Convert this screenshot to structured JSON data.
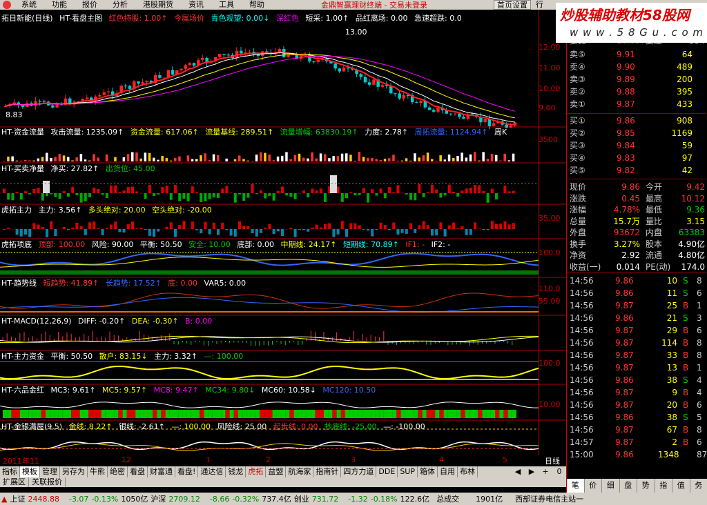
{
  "menu": {
    "items": [
      "系统",
      "功能",
      "报价",
      "分析",
      "港股期货",
      "资讯",
      "工具",
      "帮助"
    ],
    "app_title": "金鼎智赢理财终端 - 交易未登录",
    "home_btn": "首页设置",
    "row_btn": "行"
  },
  "watermark": {
    "line1": "炒股辅助教材58股网",
    "line2": "w w w . 5 8 G u . c o m"
  },
  "panels": {
    "main": {
      "items": [
        "拓日新能(日线)",
        "HT-看盘主图",
        "红色持股: 1.00↑",
        "今属场价",
        "青色观望: 0.00↓",
        "深红色",
        "短采: 1.00↑",
        "品红离场: 0.00",
        "急速超跌: 0.0"
      ],
      "yticks": [
        "12.00",
        "11.00",
        "10.00",
        "9.00"
      ],
      "annot": "13.00",
      "low": "8.83"
    },
    "p1": {
      "items": [
        "HT-资金流量",
        "攻击流量: 1235.09↑",
        "资金流量: 617.06↑",
        "流量基线: 289.51↑",
        "流量增幅: 63830.19↑",
        "力度: 2.78↑",
        "周拓流量: 1124.94↑",
        "周K"
      ],
      "ytick": "3500"
    },
    "p2": {
      "items": [
        "HT-买卖净量",
        "净买: 27.82↑",
        "出货位: 45.00"
      ]
    },
    "p3": {
      "items": [
        "虎拓主力",
        "主力: 3.56↑",
        "多头绝对: 20.00",
        "空头绝对: -20.00"
      ],
      "ytick": "35.00"
    },
    "p4": {
      "items": [
        "虎拓项底",
        "顶部: 100.00",
        "风险: 90.00",
        "平衡: 50.50",
        "安全: 10.00",
        "底部: 0.00",
        "中期线: 24.17↑",
        "短期线: 70.89↑",
        "IF1: -",
        "IF2: -"
      ],
      "ytick": "100.0"
    },
    "p5": {
      "items": [
        "HT-趋势线",
        "短趋势: 41.89↑",
        "长趋势: 17.52↑",
        "底: 0.00",
        "VAR5: 0.00"
      ],
      "yticks": [
        "110.0",
        "55.00"
      ]
    },
    "p6": {
      "items": [
        "HT-MACD(12,26,9)",
        "DIFF: -0.20↑",
        "DEA: -0.30↑",
        "B: 0.00"
      ]
    },
    "p7": {
      "items": [
        "HT-主力资金",
        "平衡: 50.50",
        "散户: 83.15↓",
        "主力: 3.32↑",
        "—: 100.00"
      ],
      "ytick": "100.0"
    },
    "p8": {
      "items": [
        "HT-六品金红",
        "MC3: 9.61↑",
        "MC5: 9.57↑",
        "MC8: 9.47↑",
        "MC34: 9.80↓",
        "MC60: 10.58↓",
        "MC120: 10.50"
      ],
      "ytick": "10.00"
    },
    "p9": {
      "items": [
        "HT-金银满屋(9,5)",
        "金线: 8.22↑",
        "银线: -2.61↑",
        "—: 100.00",
        "风险线: 25.00",
        "起步线: 0.00",
        "抄底线: -25.00",
        "—: -100.00"
      ]
    }
  },
  "dates": [
    "2011年11",
    "12",
    "1",
    "2",
    "3",
    "4",
    "5"
  ],
  "day_label": "日线",
  "tabs": [
    "指标",
    "模板",
    "管理",
    "另存为",
    "牛熊",
    "绝密",
    "看盘",
    "财富通",
    "看盘!",
    "通达信",
    "钱龙",
    "虎拓",
    "益盟",
    "航海家",
    "指南针",
    "四方力道",
    "DDE",
    "SUP",
    "箱体",
    "自用",
    "布林"
  ],
  "tabs2": [
    "扩展区",
    "关联报价"
  ],
  "tab_controls": [
    "◀",
    "▶",
    "+",
    "0"
  ],
  "orderbook": {
    "head": {
      "label": "委比",
      "value": "10.00%",
      "label2": "委差",
      "value2": "334"
    },
    "sells": [
      {
        "label": "卖⑤",
        "price": "9.91",
        "qty": "64"
      },
      {
        "label": "卖④",
        "price": "9.90",
        "qty": "489"
      },
      {
        "label": "卖③",
        "price": "9.89",
        "qty": "200"
      },
      {
        "label": "卖②",
        "price": "9.88",
        "qty": "395"
      },
      {
        "label": "卖①",
        "price": "9.87",
        "qty": "433"
      }
    ],
    "buys": [
      {
        "label": "买①",
        "price": "9.86",
        "qty": "908"
      },
      {
        "label": "买②",
        "price": "9.85",
        "qty": "1169"
      },
      {
        "label": "买③",
        "price": "9.84",
        "qty": "59"
      },
      {
        "label": "买④",
        "price": "9.83",
        "qty": "97"
      },
      {
        "label": "买⑤",
        "price": "9.82",
        "qty": "42"
      }
    ]
  },
  "quote": [
    {
      "k": "现价",
      "v": "9.86",
      "k2": "今开",
      "v2": "9.42"
    },
    {
      "k": "涨跌",
      "v": "0.45",
      "k2": "最高",
      "v2": "10.12"
    },
    {
      "k": "涨幅",
      "v": "4.78%",
      "k2": "最低",
      "v2": "9.36"
    },
    {
      "k": "总量",
      "v": "15.7万",
      "k2": "量比",
      "v2": "3.15"
    },
    {
      "k": "外盘",
      "v": "93672",
      "k2": "内盘",
      "v2": "63383"
    },
    {
      "k": "换手",
      "v": "3.27%",
      "k2": "股本",
      "v2": "4.90亿"
    },
    {
      "k": "净资",
      "v": "2.92",
      "k2": "流通",
      "v2": "4.80亿"
    },
    {
      "k": "收益(一)",
      "v": "0.014",
      "k2": "PE(动)",
      "v2": "174.0"
    }
  ],
  "ticks": [
    {
      "t": "14:56",
      "p": "9.86",
      "v": "10",
      "bs": "S",
      "n": "8"
    },
    {
      "t": "14:56",
      "p": "9.86",
      "v": "11",
      "bs": "S",
      "n": "6"
    },
    {
      "t": "14:56",
      "p": "9.87",
      "v": "25",
      "bs": "B",
      "n": "1"
    },
    {
      "t": "14:56",
      "p": "9.86",
      "v": "21",
      "bs": "S",
      "n": "3"
    },
    {
      "t": "14:56",
      "p": "9.87",
      "v": "29",
      "bs": "B",
      "n": "6"
    },
    {
      "t": "14:56",
      "p": "9.87",
      "v": "114",
      "bs": "B",
      "n": "8"
    },
    {
      "t": "14:56",
      "p": "9.87",
      "v": "33",
      "bs": "B",
      "n": "8"
    },
    {
      "t": "14:56",
      "p": "9.87",
      "v": "13",
      "bs": "B",
      "n": "1"
    },
    {
      "t": "14:56",
      "p": "9.86",
      "v": "38",
      "bs": "S",
      "n": "4"
    },
    {
      "t": "14:56",
      "p": "9.87",
      "v": "9",
      "bs": "B",
      "n": "4"
    },
    {
      "t": "14:56",
      "p": "9.87",
      "v": "20",
      "bs": "B",
      "n": "6"
    },
    {
      "t": "14:56",
      "p": "9.86",
      "v": "38",
      "bs": "S",
      "n": "5"
    },
    {
      "t": "14:56",
      "p": "9.87",
      "v": "67",
      "bs": "B",
      "n": "8"
    },
    {
      "t": "14:57",
      "p": "9.87",
      "v": "2",
      "bs": "B",
      "n": "6"
    },
    {
      "t": "15:00",
      "p": "9.86",
      "v": "1348",
      "bs": "",
      "n": "87"
    }
  ],
  "side_tabs": [
    "笔",
    "价",
    "细",
    "盘",
    "势",
    "指",
    "值",
    "务"
  ],
  "status": {
    "sh_label": "上证",
    "sh_val": "2448.88",
    "sh_chg": "-3.07",
    "sh_pct": "-0.13%",
    "sh_amt": "1050亿",
    "sz_label": "沪深",
    "sz_val": "2709.12",
    "sz_chg": "-8.66",
    "sz_pct": "-0.32%",
    "sz_amt": "737.4亿",
    "cy_label": "创业",
    "cy_val": "731.72",
    "cy_chg": "-1.32",
    "cy_pct": "-0.18%",
    "cy_amt": "122.6亿",
    "total_label": "总成交",
    "total_amt": "1901亿",
    "broker": "西部证券电信主站一"
  }
}
